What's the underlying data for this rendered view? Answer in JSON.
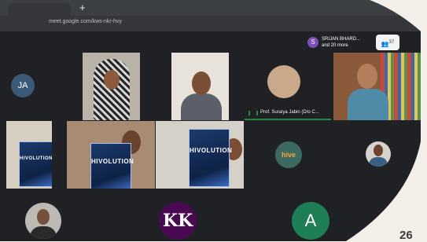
{
  "browser": {
    "new_tab_label": "+",
    "url": "meet.google.com/kws-nkr-hvy"
  },
  "presenter": {
    "avatar_letter": "S",
    "name": "SRIJAN BHARD...",
    "more": "and 20 more"
  },
  "people_button": {
    "count": "37"
  },
  "tiles": {
    "ja_initials": "JA",
    "speaker_name": "Prof. Suraiya Jabin (D/o C...",
    "hive_text": "hive",
    "book_title": "HIVOLUTION",
    "a_initial": "A",
    "monogram_text": "KK"
  },
  "page_number": "26",
  "colors": {
    "meet_background": "#202124",
    "page_background": "#f4efe9",
    "speaking_indicator": "#1e8e3e",
    "a_avatar": "#1e7e55",
    "monogram_bg": "#4a0a53"
  }
}
